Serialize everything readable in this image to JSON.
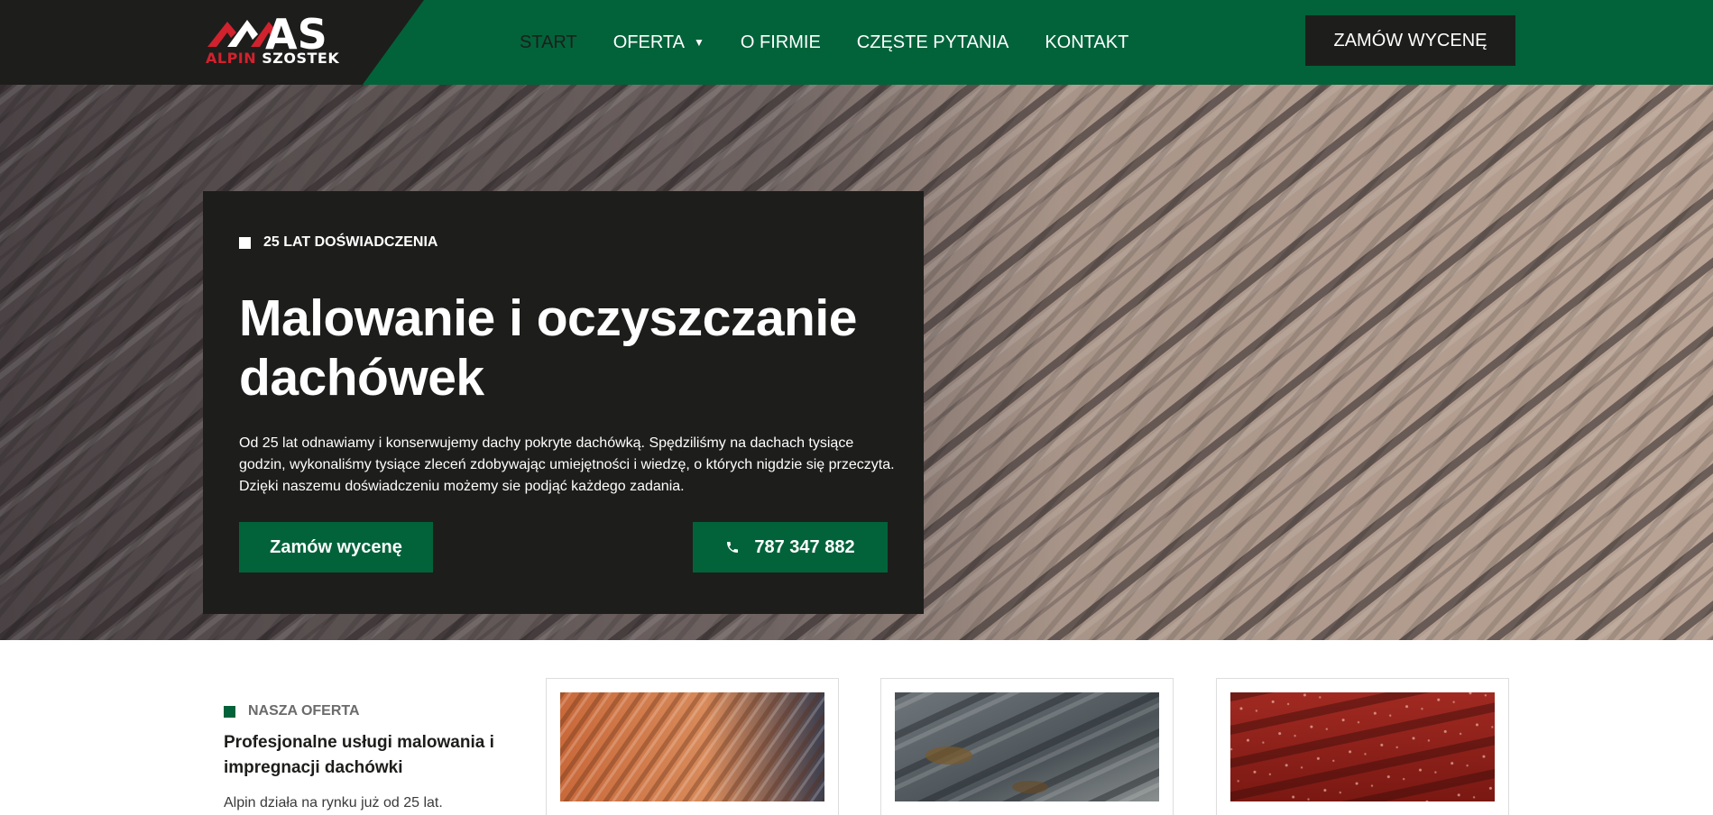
{
  "header": {
    "logo": {
      "mark_text": "AS",
      "word1": "ALPIN",
      "word2": "SZOSTEK"
    },
    "nav": [
      {
        "label": "START",
        "active": true
      },
      {
        "label": "OFERTA",
        "has_dropdown": true
      },
      {
        "label": "O FIRMIE"
      },
      {
        "label": "CZĘSTE PYTANIA"
      },
      {
        "label": "KONTAKT"
      }
    ],
    "cta_label": "ZAMÓW WYCENĘ"
  },
  "hero": {
    "eyebrow": "25 LAT DOŚWIADCZENIA",
    "title": "Malowanie i oczyszczanie dachówek",
    "description": "Od 25 lat odnawiamy i konserwujemy dachy pokryte dachówką. Spędziliśmy na dachach tysiące godzin, wykonaliśmy tysiące zleceń zdobywając umiejętności i wiedzę, o których nigdzie się przeczyta. Dzięki naszemu doświadczeniu możemy sie podjąć każdego zadania.",
    "quote_button": "Zamów wycenę",
    "phone_button": "787 347 882"
  },
  "offer": {
    "eyebrow": "NASZA OFERTA",
    "title": "Profesjonalne usługi malowania i impregnacji dachówki",
    "text": "Alpin działa na rynku już od 25 lat."
  },
  "colors": {
    "brand_green": "#02633a",
    "dark": "#1d1e1b",
    "logo_red": "#d1222e"
  },
  "icons": [
    "phone-icon",
    "chevron-down-icon"
  ]
}
